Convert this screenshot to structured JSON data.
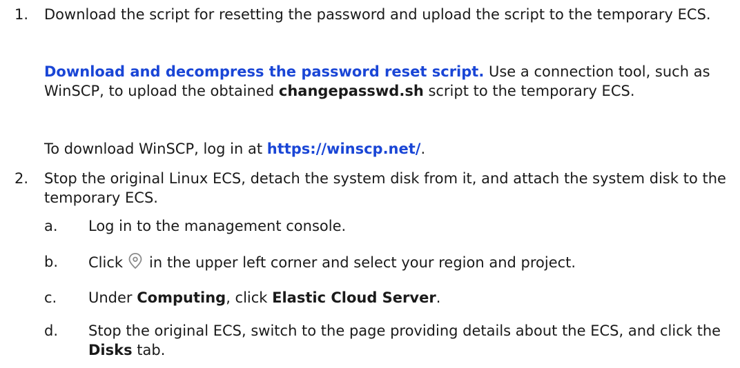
{
  "steps": [
    {
      "num": "1.",
      "text": "Download the script for resetting the password and upload the script to the temporary ECS.",
      "para1": {
        "link": "Download and decompress the password reset script.",
        "t1": " Use a connection tool, such as WinSCP, to upload the obtained ",
        "bold": "changepasswd.sh",
        "t2": " script to the temporary ECS."
      },
      "para2": {
        "t1": "To download WinSCP, log in at ",
        "link": "https://winscp.net/",
        "t2": "."
      }
    },
    {
      "num": "2.",
      "text": "Stop the original Linux ECS, detach the system disk from it, and attach the system disk to the temporary ECS.",
      "substeps": [
        {
          "num": "a.",
          "text": "Log in to the management console."
        },
        {
          "num": "b.",
          "t1": "Click",
          "icon": "location-pin-icon",
          "t2": "in the upper left corner and select your region and project."
        },
        {
          "num": "c.",
          "t1": "Under ",
          "b1": "Computing",
          "t2": ", click ",
          "b2": "Elastic Cloud Server",
          "t3": "."
        },
        {
          "num": "d.",
          "t1": "Stop the original ECS, switch to the page providing details about the ECS, and click the ",
          "b1": "Disks",
          "t2": " tab."
        }
      ]
    }
  ]
}
